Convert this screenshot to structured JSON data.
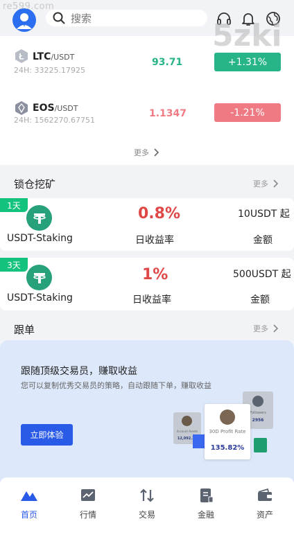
{
  "watermark": {
    "text": "re599.com",
    "brand": "5zki"
  },
  "header": {
    "search_placeholder": "搜索",
    "icons": [
      "avatar-icon",
      "headset-icon",
      "bell-icon",
      "globe-icon"
    ]
  },
  "market": {
    "rows": [
      {
        "symbol": "LTC",
        "quote": "/USDT",
        "volume": "24H: 33225.17925",
        "price": "93.71",
        "change": "+1.31%",
        "trend": "up"
      },
      {
        "symbol": "EOS",
        "quote": "/USDT",
        "volume": "24H: 1562270.67751",
        "price": "1.1347",
        "change": "-1.21%",
        "trend": "down"
      }
    ],
    "more_label": "更多"
  },
  "staking": {
    "title": "锁仓挖矿",
    "more_label": "更多",
    "items": [
      {
        "badge": "1天",
        "name": "USDT-Staking",
        "rate": "0.8%",
        "rate_label": "日收益率",
        "min": "10USDT 起",
        "amount_label": "金额"
      },
      {
        "badge": "3天",
        "name": "USDT-Staking",
        "rate": "1%",
        "rate_label": "日收益率",
        "min": "500USDT 起",
        "amount_label": "金额"
      }
    ]
  },
  "copy_trade": {
    "title": "跟单",
    "more_label": "更多",
    "headline": "跟随顶级交易员，赚取收益",
    "description": "您可以复制优秀交易员的策略，自动跟随下单，赚取收益",
    "button": "立即体验",
    "card_main": {
      "label": "30D Profit Rate",
      "value": "135.82%"
    },
    "card_left": {
      "label": "Account Assets",
      "value": "12,092.33"
    },
    "card_right": {
      "label": "Followers",
      "value": "2956"
    }
  },
  "tabbar": {
    "items": [
      {
        "label": "首页",
        "icon": "home-icon",
        "active": true
      },
      {
        "label": "行情",
        "icon": "chart-icon",
        "active": false
      },
      {
        "label": "交易",
        "icon": "trade-arrows-icon",
        "active": false
      },
      {
        "label": "金融",
        "icon": "finance-icon",
        "active": false
      },
      {
        "label": "资产",
        "icon": "wallet-icon",
        "active": false
      }
    ]
  },
  "colors": {
    "up": "#26b488",
    "down": "#f07a84",
    "accent": "#2a5be8",
    "staking_green": "#13c37d",
    "tether": "#26a17b"
  }
}
